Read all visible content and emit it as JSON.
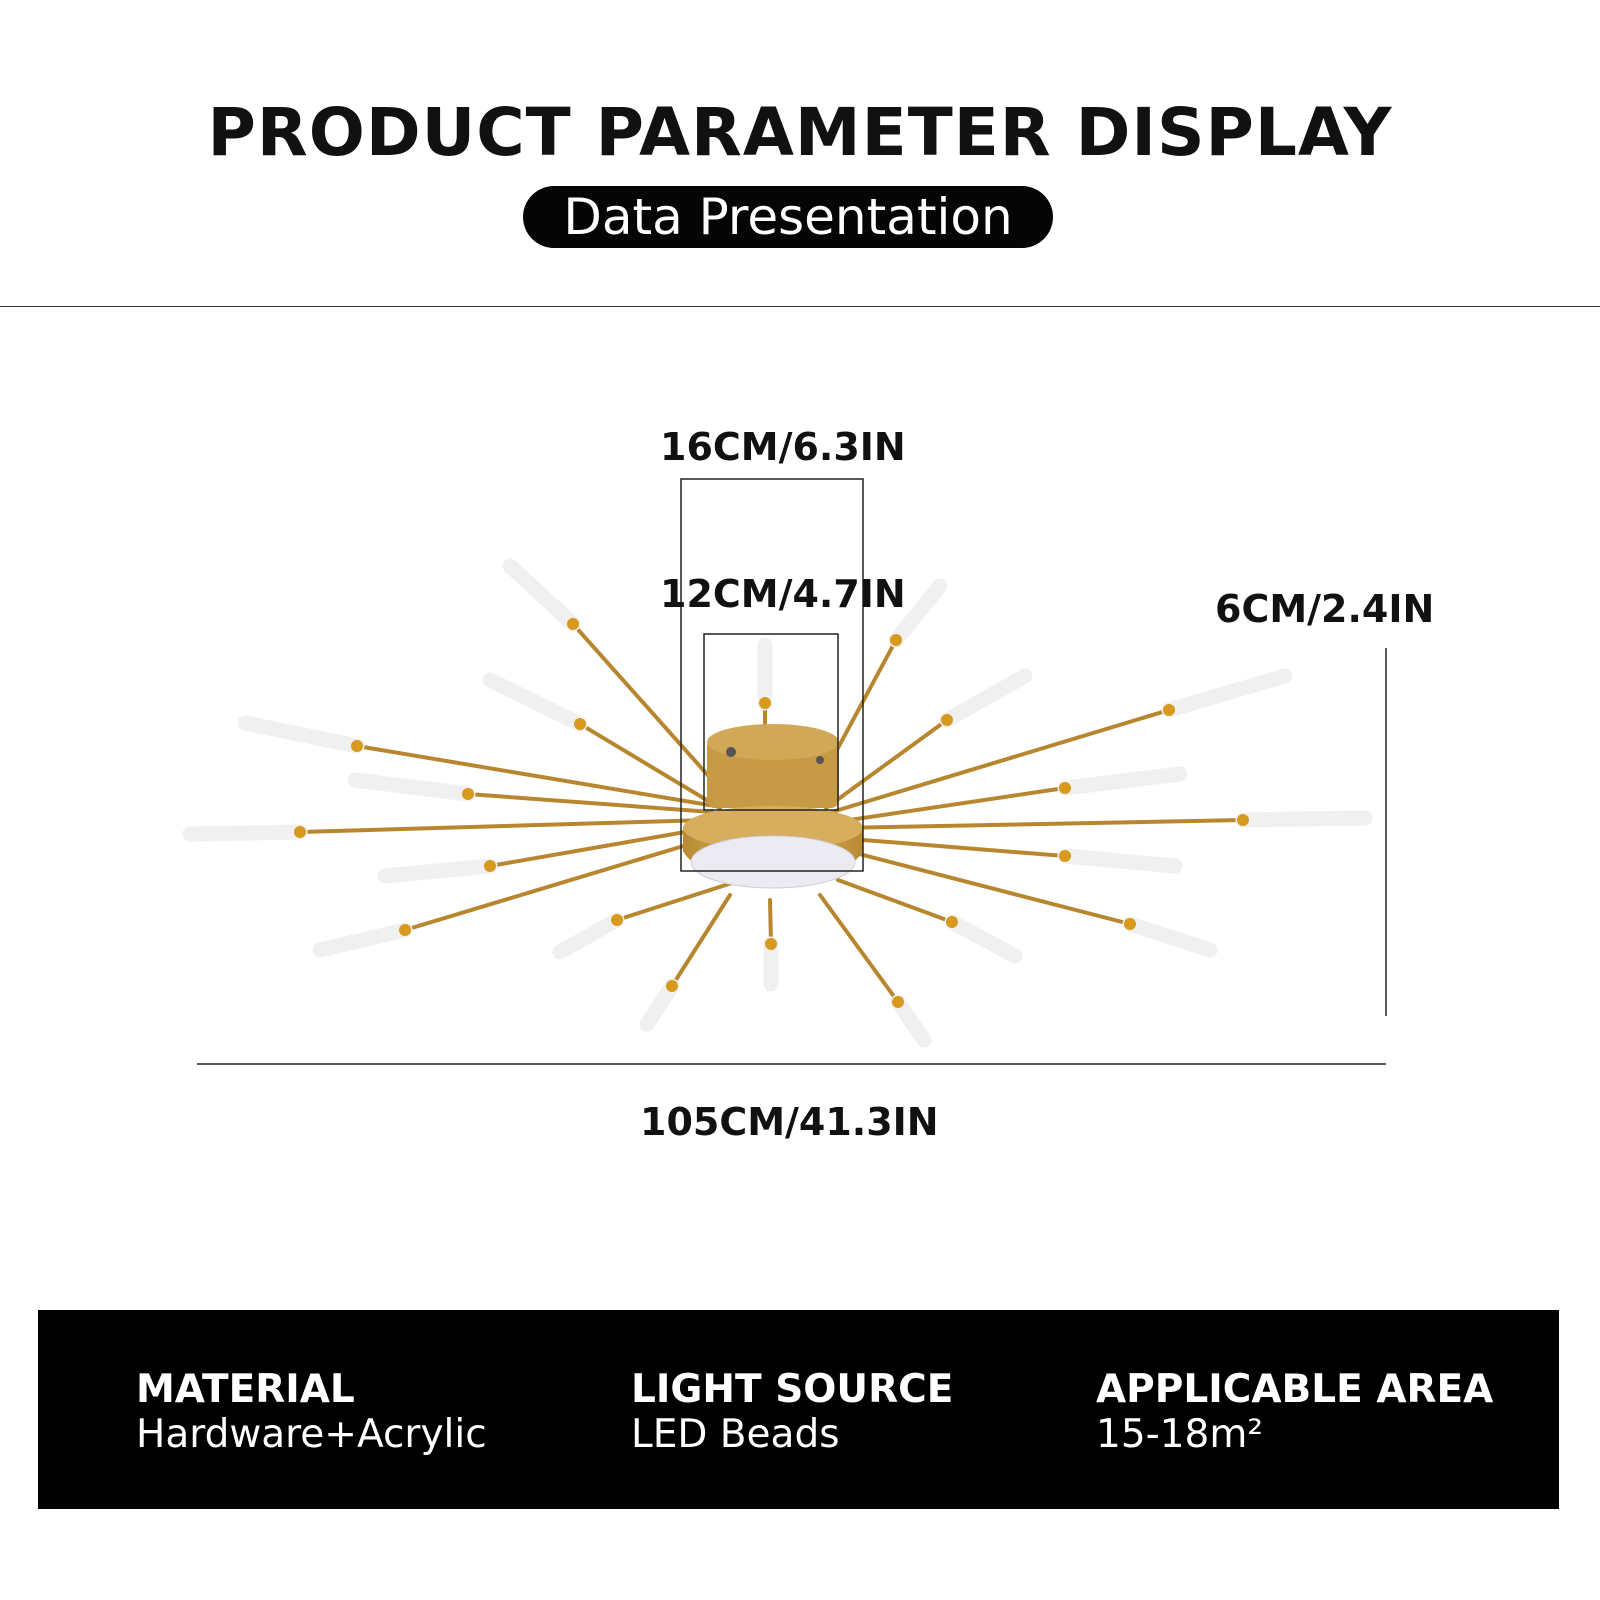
{
  "header": {
    "title": "PRODUCT PARAMETER DISPLAY",
    "subtitle": "Data Presentation"
  },
  "dimensions": {
    "canopy_outer": "16CM/6.3IN",
    "canopy_inner": "12CM/4.7IN",
    "height": "6CM/2.4IN",
    "total_width": "105CM/41.3IN"
  },
  "product_image": {
    "subject": "gold starburst LED ceiling light",
    "colors": {
      "rod": "#b8862e",
      "base": "#c9a14a",
      "shade": "#f7f7f7",
      "diffuser": "#ecebf2"
    }
  },
  "specs": [
    {
      "label": "MATERIAL",
      "value": "Hardware+Acrylic"
    },
    {
      "label": "LIGHT SOURCE",
      "value": "LED Beads"
    },
    {
      "label": "APPLICABLE AREA",
      "value": "15-18m²"
    }
  ],
  "colors": {
    "background": "#ffffff",
    "text": "#111111",
    "pill": "#050505",
    "spec_bar": "#000000"
  }
}
